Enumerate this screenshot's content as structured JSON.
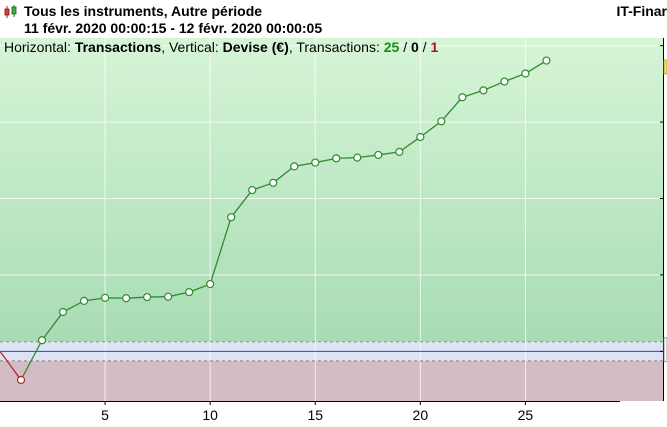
{
  "window": {
    "title": "Tous les instruments, Autre période",
    "period": "11 févr. 2020 00:00:15 - 12 févr. 2020 00:00:05",
    "brand": "IT-Finar"
  },
  "info_line": {
    "horizontal_label": "Horizontal: ",
    "horizontal_value": "Transactions",
    "vertical_label": ", Vertical: ",
    "vertical_value": "Devise (€)",
    "transactions_label": ", Transactions: ",
    "winning": "25",
    "separator": " / ",
    "neutral": "0",
    "losing": "1"
  },
  "icons": {
    "app": "candlestick-chart-icon"
  },
  "colors": {
    "profit_zone_top": "#d6f5d6",
    "profit_zone_bottom": "#a8dcb4",
    "loss_zone": "#d3bcc3",
    "breakeven_band": "#dde3f5",
    "breakeven_line": "#3a3ad0",
    "equity_line": "#2e8b2e",
    "loss_segment": "#b02828",
    "grid": "#ffffff"
  },
  "chart_data": {
    "type": "line",
    "title": "",
    "xlabel": "",
    "ylabel": "",
    "x_ticks": [
      "5",
      "10",
      "15",
      "20",
      "25"
    ],
    "xlim": [
      0,
      29.5
    ],
    "ylim": [
      -130,
      820
    ],
    "grid": true,
    "breakeven": 0,
    "band": [
      -25,
      25
    ],
    "series": [
      {
        "x": [
          0,
          1,
          2,
          3,
          4,
          5,
          6,
          7,
          8,
          9,
          10,
          11,
          12,
          13,
          14,
          15,
          16,
          17,
          18,
          19,
          20,
          21,
          22,
          23,
          24,
          25,
          26
        ],
        "y": [
          0,
          -75,
          29,
          103,
          132,
          140,
          139,
          142,
          143,
          155,
          176,
          351,
          422,
          441,
          484,
          494,
          505,
          507,
          514,
          522,
          561,
          602,
          665,
          683,
          706,
          727,
          761
        ]
      }
    ]
  }
}
